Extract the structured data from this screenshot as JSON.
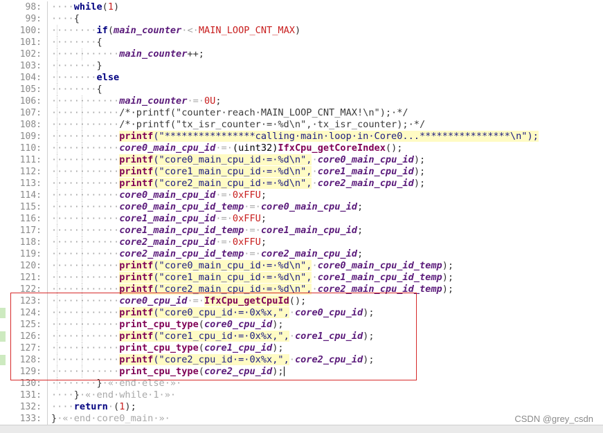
{
  "editor": {
    "lines": [
      {
        "n": "98:",
        "indent": 1,
        "tokens": [
          [
            "kw",
            "while"
          ],
          [
            "op",
            "("
          ],
          [
            "num",
            "1"
          ],
          [
            "op",
            ")"
          ]
        ]
      },
      {
        "n": "99:",
        "indent": 1,
        "tokens": [
          [
            "op",
            "{"
          ]
        ]
      },
      {
        "n": "100:",
        "indent": 2,
        "tokens": [
          [
            "kw",
            "if"
          ],
          [
            "op",
            "("
          ],
          [
            "var",
            "main_counter"
          ],
          [
            "ws",
            "·<·"
          ],
          [
            "mac",
            "MAIN_LOOP_CNT_MAX"
          ],
          [
            "op",
            ")"
          ]
        ]
      },
      {
        "n": "101:",
        "indent": 2,
        "tokens": [
          [
            "op",
            "{"
          ]
        ]
      },
      {
        "n": "102:",
        "indent": 3,
        "tokens": [
          [
            "var",
            "main_counter"
          ],
          [
            "op",
            "++;"
          ]
        ]
      },
      {
        "n": "103:",
        "indent": 2,
        "tokens": [
          [
            "op",
            "}"
          ]
        ]
      },
      {
        "n": "104:",
        "indent": 2,
        "tokens": [
          [
            "kw",
            "else"
          ]
        ]
      },
      {
        "n": "105:",
        "indent": 2,
        "tokens": [
          [
            "op",
            "{"
          ]
        ]
      },
      {
        "n": "106:",
        "indent": 3,
        "tokens": [
          [
            "var",
            "main_counter"
          ],
          [
            "ws",
            "·=·"
          ],
          [
            "num",
            "0U"
          ],
          [
            "op",
            ";"
          ]
        ]
      },
      {
        "n": "107:",
        "indent": 3,
        "tokens": [
          [
            "cm",
            "/*·printf(\"counter·reach·MAIN_LOOP_CNT_MAX!\\n\");·*/"
          ]
        ]
      },
      {
        "n": "108:",
        "indent": 3,
        "tokens": [
          [
            "cm",
            "/*·printf(\"tx_isr_counter·=·%d\\n\",·tx_isr_counter);·*/"
          ]
        ]
      },
      {
        "n": "109:",
        "indent": 3,
        "tokens": [
          [
            "fn hl",
            "printf"
          ],
          [
            "str hl",
            "(\"****************calling·main·loop·in·Core0...****************\\n\");"
          ]
        ]
      },
      {
        "n": "110:",
        "indent": 3,
        "tokens": [
          [
            "var",
            "core0_main_cpu_id"
          ],
          [
            "ws",
            "·=·"
          ],
          [
            "plain",
            "(uint32)"
          ],
          [
            "fn",
            "IfxCpu_getCoreIndex"
          ],
          [
            "op",
            "();"
          ]
        ]
      },
      {
        "n": "111:",
        "indent": 3,
        "tokens": [
          [
            "fn hl",
            "printf"
          ],
          [
            "str hl",
            "(\"core0_main_cpu_id·=·%d\\n\","
          ],
          [
            "ws",
            "·"
          ],
          [
            "var",
            "core0_main_cpu_id"
          ],
          [
            "op",
            ");"
          ]
        ]
      },
      {
        "n": "112:",
        "indent": 3,
        "tokens": [
          [
            "fn hl",
            "printf"
          ],
          [
            "str hl",
            "(\"core1_main_cpu_id·=·%d\\n\","
          ],
          [
            "ws",
            "·"
          ],
          [
            "var",
            "core1_main_cpu_id"
          ],
          [
            "op",
            ");"
          ]
        ]
      },
      {
        "n": "113:",
        "indent": 3,
        "tokens": [
          [
            "fn hl",
            "printf"
          ],
          [
            "str hl",
            "(\"core2_main_cpu_id·=·%d\\n\","
          ],
          [
            "ws",
            "·"
          ],
          [
            "var",
            "core2_main_cpu_id"
          ],
          [
            "op",
            ");"
          ]
        ]
      },
      {
        "n": "114:",
        "indent": 3,
        "tokens": [
          [
            "var",
            "core0_main_cpu_id"
          ],
          [
            "ws",
            "·=·"
          ],
          [
            "num",
            "0xFFU"
          ],
          [
            "op",
            ";"
          ]
        ]
      },
      {
        "n": "115:",
        "indent": 3,
        "tokens": [
          [
            "var",
            "core0_main_cpu_id_temp"
          ],
          [
            "ws",
            "·=·"
          ],
          [
            "var",
            "core0_main_cpu_id"
          ],
          [
            "op",
            ";"
          ]
        ]
      },
      {
        "n": "116:",
        "indent": 3,
        "tokens": [
          [
            "var",
            "core1_main_cpu_id"
          ],
          [
            "ws",
            "·=·"
          ],
          [
            "num",
            "0xFFU"
          ],
          [
            "op",
            ";"
          ]
        ]
      },
      {
        "n": "117:",
        "indent": 3,
        "tokens": [
          [
            "var",
            "core1_main_cpu_id_temp"
          ],
          [
            "ws",
            "·=·"
          ],
          [
            "var",
            "core1_main_cpu_id"
          ],
          [
            "op",
            ";"
          ]
        ]
      },
      {
        "n": "118:",
        "indent": 3,
        "tokens": [
          [
            "var",
            "core2_main_cpu_id"
          ],
          [
            "ws",
            "·=·"
          ],
          [
            "num",
            "0xFFU"
          ],
          [
            "op",
            ";"
          ]
        ]
      },
      {
        "n": "119:",
        "indent": 3,
        "tokens": [
          [
            "var",
            "core2_main_cpu_id_temp"
          ],
          [
            "ws",
            "·=·"
          ],
          [
            "var",
            "core2_main_cpu_id"
          ],
          [
            "op",
            ";"
          ]
        ]
      },
      {
        "n": "120:",
        "indent": 3,
        "tokens": [
          [
            "fn hl",
            "printf"
          ],
          [
            "str hl",
            "(\"core0_main_cpu_id·=·%d\\n\","
          ],
          [
            "ws",
            "·"
          ],
          [
            "var",
            "core0_main_cpu_id_temp"
          ],
          [
            "op",
            ");"
          ]
        ]
      },
      {
        "n": "121:",
        "indent": 3,
        "tokens": [
          [
            "fn hl",
            "printf"
          ],
          [
            "str hl",
            "(\"core1_main_cpu_id·=·%d\\n\","
          ],
          [
            "ws",
            "·"
          ],
          [
            "var",
            "core1_main_cpu_id_temp"
          ],
          [
            "op",
            ");"
          ]
        ]
      },
      {
        "n": "122:",
        "indent": 3,
        "tokens": [
          [
            "fn hl",
            "printf"
          ],
          [
            "str hl",
            "(\"core2_main_cpu_id·=·%d\\n\","
          ],
          [
            "ws",
            "·"
          ],
          [
            "var",
            "core2_main_cpu_id_temp"
          ],
          [
            "op",
            ");"
          ]
        ]
      },
      {
        "n": "123:",
        "indent": 3,
        "tokens": [
          [
            "var",
            "core0_cpu_id"
          ],
          [
            "ws",
            "·=·"
          ],
          [
            "fn hl",
            "IfxCpu_getCpuId"
          ],
          [
            "op",
            "();"
          ]
        ]
      },
      {
        "n": "124:",
        "indent": 3,
        "mark": true,
        "tokens": [
          [
            "fn hl",
            "printf"
          ],
          [
            "str hl",
            "(\"core0_cpu_id·=·0x%x,\","
          ],
          [
            "ws",
            "·"
          ],
          [
            "var",
            "core0_cpu_id"
          ],
          [
            "op",
            ");"
          ]
        ]
      },
      {
        "n": "125:",
        "indent": 3,
        "tokens": [
          [
            "fn",
            "print_cpu_type"
          ],
          [
            "op",
            "("
          ],
          [
            "var",
            "core0_cpu_id"
          ],
          [
            "op",
            ");"
          ]
        ]
      },
      {
        "n": "126:",
        "indent": 3,
        "mark": true,
        "tokens": [
          [
            "fn hl",
            "printf"
          ],
          [
            "str hl",
            "(\"core1_cpu_id·=·0x%x,\","
          ],
          [
            "ws",
            "·"
          ],
          [
            "var",
            "core1_cpu_id"
          ],
          [
            "op",
            ");"
          ]
        ]
      },
      {
        "n": "127:",
        "indent": 3,
        "tokens": [
          [
            "fn",
            "print_cpu_type"
          ],
          [
            "op",
            "("
          ],
          [
            "var",
            "core1_cpu_id"
          ],
          [
            "op",
            ");"
          ]
        ]
      },
      {
        "n": "128:",
        "indent": 3,
        "mark": true,
        "tokens": [
          [
            "fn hl",
            "printf"
          ],
          [
            "str hl",
            "(\"core2_cpu_id·=·0x%x,\","
          ],
          [
            "ws",
            "·"
          ],
          [
            "var",
            "core2_cpu_id"
          ],
          [
            "op",
            ");"
          ]
        ]
      },
      {
        "n": "129:",
        "indent": 3,
        "cursor": true,
        "tokens": [
          [
            "fn",
            "print_cpu_type"
          ],
          [
            "op",
            "("
          ],
          [
            "var",
            "core2_cpu_id"
          ],
          [
            "op",
            ");"
          ]
        ]
      },
      {
        "n": "130:",
        "indent": 2,
        "tokens": [
          [
            "op",
            "}"
          ],
          [
            "ws",
            "·«·end·else·»·"
          ]
        ]
      },
      {
        "n": "131:",
        "indent": 1,
        "tokens": [
          [
            "op",
            "}"
          ],
          [
            "ws",
            "·«·end·while·1·»·"
          ]
        ]
      },
      {
        "n": "132:",
        "indent": 1,
        "tokens": [
          [
            "kw",
            "return"
          ],
          [
            "ws",
            "·"
          ],
          [
            "op",
            "("
          ],
          [
            "num",
            "1"
          ],
          [
            "op",
            ");"
          ]
        ]
      },
      {
        "n": "133:",
        "indent": 0,
        "tokens": [
          [
            "op",
            "}"
          ],
          [
            "ws",
            "·«·end·core0_main·»·"
          ]
        ]
      }
    ]
  },
  "watermark": "CSDN @grey_csdn",
  "colors": {
    "highlight": "#fffbc4",
    "selection_box": "#d62828",
    "change_marker": "#cdeac0"
  }
}
